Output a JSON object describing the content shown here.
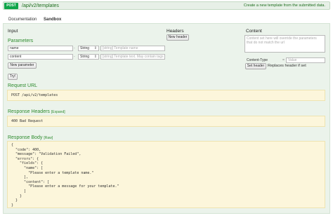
{
  "endpoint": {
    "method": "POST",
    "path": "/api/v2/templates",
    "description": "Create a new template from the submitted data."
  },
  "tabs": [
    {
      "label": "Documentation",
      "active": false
    },
    {
      "label": "Sandbox",
      "active": true
    }
  ],
  "columns": {
    "input": "Input",
    "headers": "Headers",
    "content": "Content"
  },
  "parameters": {
    "title": "Parameters",
    "rows": [
      {
        "name": "name",
        "type": "String",
        "placeholder": "[string] Template name"
      },
      {
        "name": "content",
        "type": "String",
        "placeholder": "[string] Template text. May contain tags"
      }
    ],
    "remove_symbol": "-",
    "new_parameter_label": "New parameter",
    "try_label": "Try!"
  },
  "headers": {
    "new_header_label": "New header"
  },
  "content": {
    "textarea_placeholder": "Content set here will override the parameters that do not match the url",
    "content_type_label": "Content-Type",
    "content_type_placeholder": "Value",
    "equals": "=",
    "set_header_label": "Set header",
    "replaces_hint": "Replaces header if set"
  },
  "request_url": {
    "title": "Request URL",
    "value": "POST /api/v2/templates"
  },
  "response_headers": {
    "title": "Response Headers",
    "link": "[Expand]",
    "value": "400 Bad Request"
  },
  "response_body": {
    "title": "Response Body",
    "link": "[Raw]",
    "lines": [
      "{",
      "  \"code\": 400,",
      "  \"message\": \"Validation Failed\",",
      "  \"errors\": {",
      "    \"fields\": {",
      "      \"name\": [",
      "        \"Please enter a template name.\"",
      "      ],",
      "      \"content\": [",
      "        \"Please enter a message for your template.\"",
      "      ]",
      "    }",
      "  }",
      "}"
    ]
  },
  "colors": {
    "method_badge": "#10a54a",
    "section_title": "#2e8b2e",
    "panel_bg": "#ebf3eb",
    "code_bg": "#fcf6db"
  }
}
